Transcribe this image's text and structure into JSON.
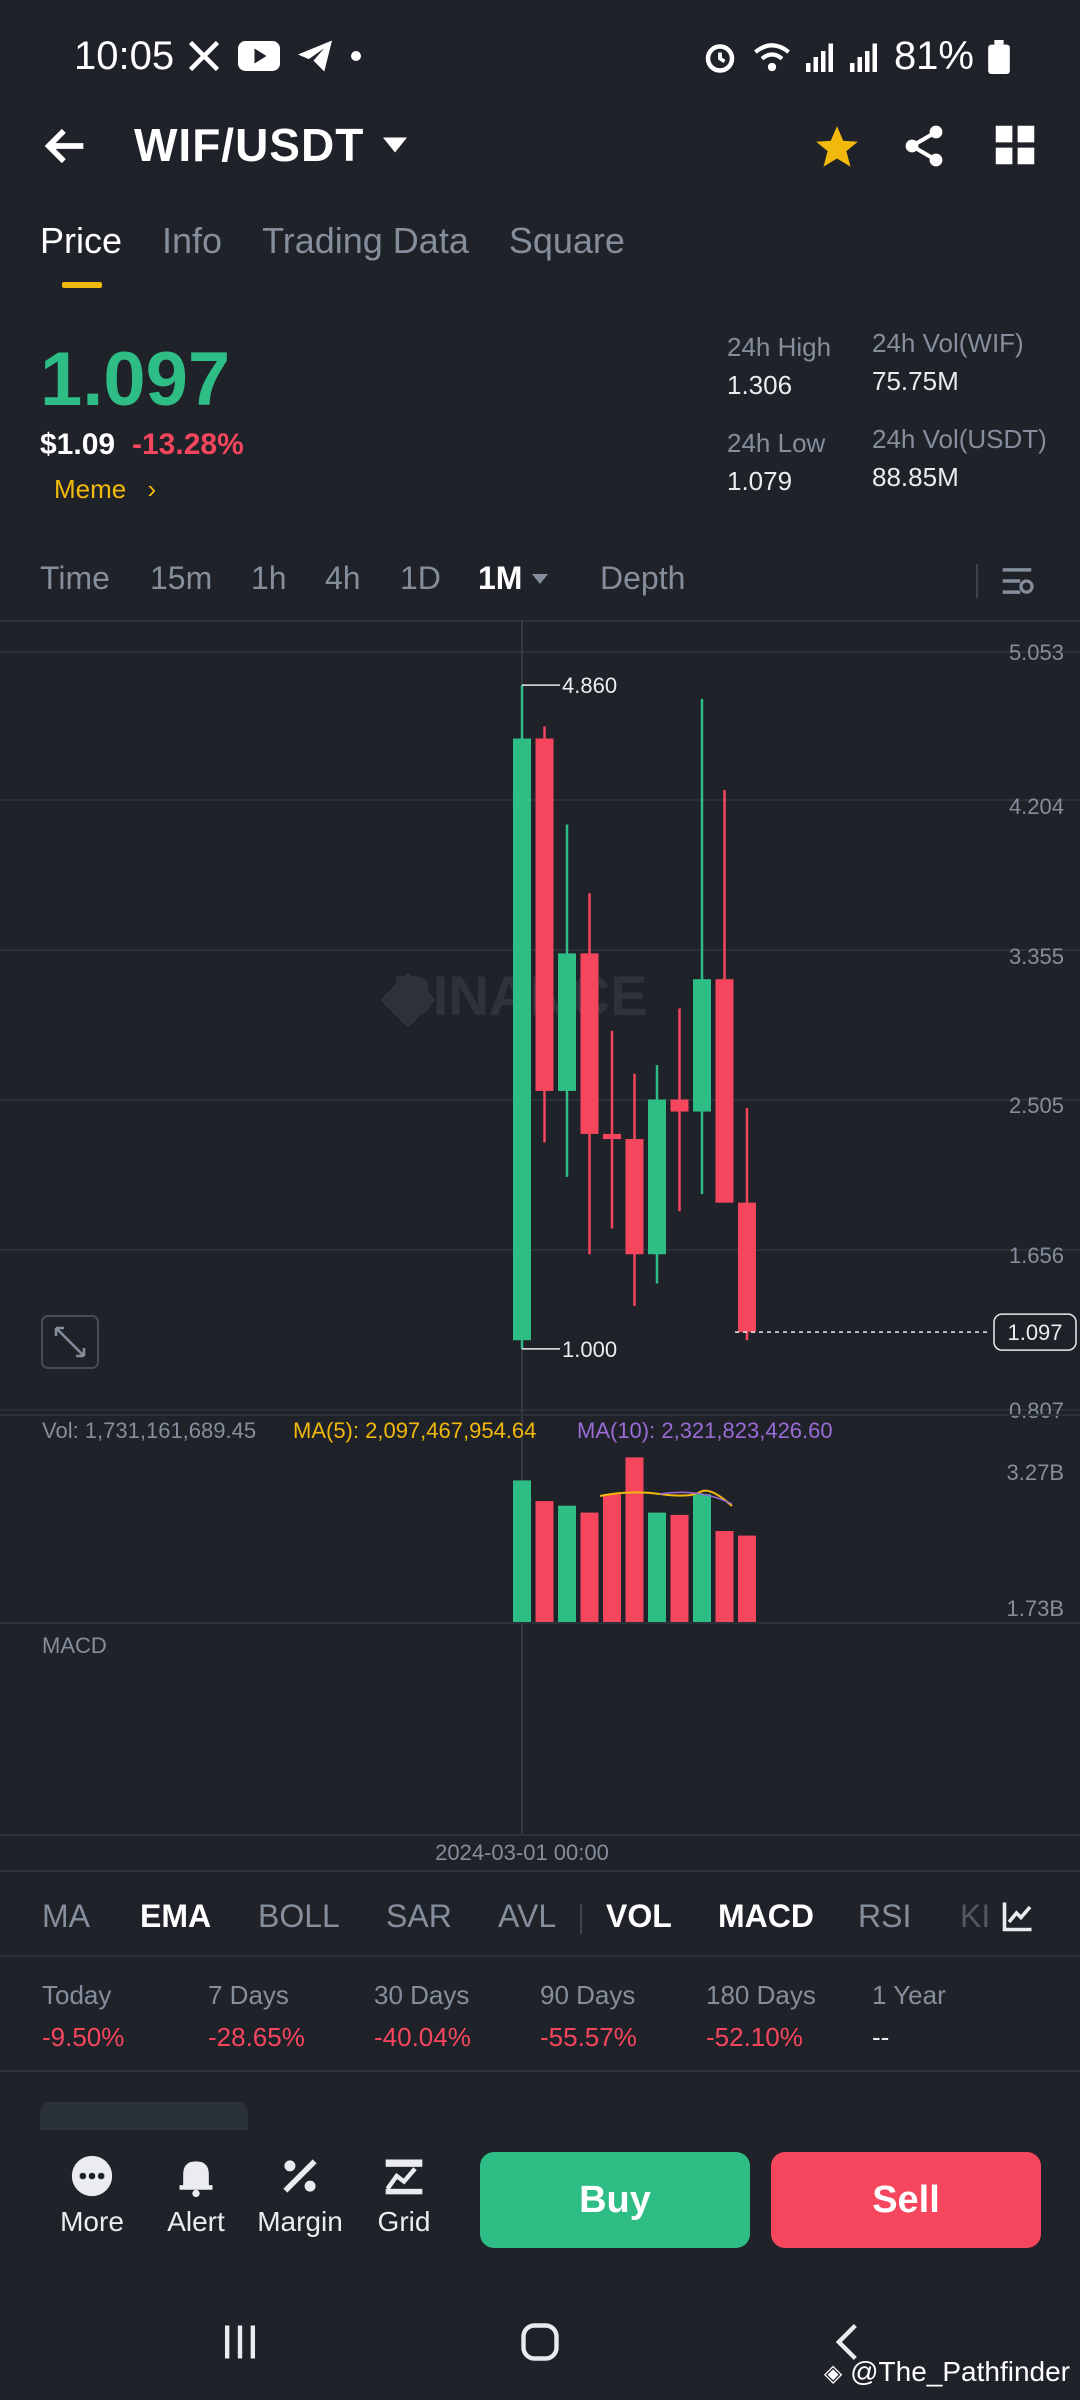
{
  "status_bar": {
    "time": "10:05",
    "battery": "81%"
  },
  "header": {
    "pair": "WIF/USDT"
  },
  "tabs": [
    {
      "label": "Price",
      "active": true
    },
    {
      "label": "Info"
    },
    {
      "label": "Trading Data"
    },
    {
      "label": "Square"
    }
  ],
  "ticker": {
    "price": "1.097",
    "usd_price": "$1.09",
    "change": "-13.28%",
    "tag": "Meme",
    "high_label": "24h High",
    "high": "1.306",
    "low_label": "24h Low",
    "low": "1.079",
    "vol_base_label": "24h Vol(WIF)",
    "vol_base": "75.75M",
    "vol_quote_label": "24h Vol(USDT)",
    "vol_quote": "88.85M"
  },
  "intervals": [
    "Time",
    "15m",
    "1h",
    "4h",
    "1D",
    "1M",
    "Depth"
  ],
  "selected_interval": "1M",
  "chart_data": {
    "type": "candlestick",
    "y_ticks": [
      "5.053",
      "4.204",
      "3.355",
      "2.505",
      "1.656",
      "0.807"
    ],
    "ylim": [
      0.807,
      5.053
    ],
    "high_marker": "4.860",
    "low_marker": "1.000",
    "last_price": "1.097",
    "watermark": "BINANCE",
    "x_label": "2024-03-01 00:00",
    "candles": [
      {
        "o": 1.05,
        "h": 4.86,
        "l": 1.0,
        "c": 4.55,
        "dir": "up"
      },
      {
        "o": 4.55,
        "h": 4.62,
        "l": 2.2,
        "c": 2.5,
        "dir": "down"
      },
      {
        "o": 2.5,
        "h": 4.05,
        "l": 2.0,
        "c": 3.3,
        "dir": "up"
      },
      {
        "o": 3.3,
        "h": 3.65,
        "l": 1.55,
        "c": 2.25,
        "dir": "down"
      },
      {
        "o": 2.25,
        "h": 2.85,
        "l": 1.7,
        "c": 2.22,
        "dir": "down"
      },
      {
        "o": 2.22,
        "h": 2.6,
        "l": 1.25,
        "c": 1.55,
        "dir": "down"
      },
      {
        "o": 1.55,
        "h": 2.65,
        "l": 1.38,
        "c": 2.45,
        "dir": "up"
      },
      {
        "o": 2.45,
        "h": 2.98,
        "l": 1.8,
        "c": 2.38,
        "dir": "down"
      },
      {
        "o": 2.38,
        "h": 4.78,
        "l": 1.9,
        "c": 3.15,
        "dir": "up"
      },
      {
        "o": 3.15,
        "h": 4.25,
        "l": 1.95,
        "c": 1.85,
        "dir": "down"
      },
      {
        "o": 1.85,
        "h": 2.4,
        "l": 1.05,
        "c": 1.097,
        "dir": "down"
      }
    ],
    "volume": {
      "label": "Vol: 1,731,161,689.45",
      "ma5_label": "MA(5): 2,097,467,954.64",
      "ma10_label": "MA(10): 2,321,823,426.60",
      "y_ticks": [
        "3.27B",
        "1.73B"
      ],
      "bars": [
        0.62,
        0.53,
        0.51,
        0.48,
        0.56,
        0.72,
        0.48,
        0.47,
        0.56,
        0.4,
        0.38
      ]
    },
    "macd_label": "MACD"
  },
  "indicators": [
    {
      "label": "MA"
    },
    {
      "label": "EMA",
      "on": true
    },
    {
      "label": "BOLL"
    },
    {
      "label": "SAR"
    },
    {
      "label": "AVL"
    },
    {
      "label": "VOL",
      "on": true
    },
    {
      "label": "MACD",
      "on": true
    },
    {
      "label": "RSI"
    },
    {
      "label": "KI"
    }
  ],
  "performance": [
    {
      "label": "Today",
      "value": "-9.50%"
    },
    {
      "label": "7 Days",
      "value": "-28.65%"
    },
    {
      "label": "30 Days",
      "value": "-40.04%"
    },
    {
      "label": "90 Days",
      "value": "-55.57%"
    },
    {
      "label": "180 Days",
      "value": "-52.10%"
    },
    {
      "label": "1 Year",
      "value": "--"
    }
  ],
  "bottom_bar": {
    "more": "More",
    "alert": "Alert",
    "margin": "Margin",
    "grid": "Grid",
    "buy": "Buy",
    "sell": "Sell"
  },
  "watermark": "@The_Pathfinder",
  "colors": {
    "up": "#2ebd85",
    "down": "#f6465d",
    "accent": "#f0b90b",
    "bg": "#1f2229"
  }
}
